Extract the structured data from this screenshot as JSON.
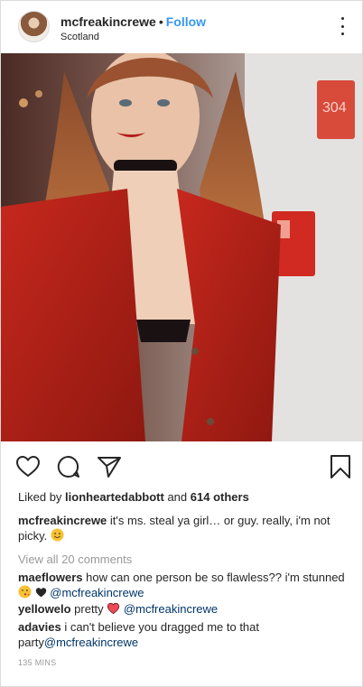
{
  "post": {
    "username": "mcfreakincrewe",
    "separator": "•",
    "follow_label": "Follow",
    "location": "Scotland"
  },
  "icons": {
    "like": "heart-outline-icon",
    "comment": "comment-bubble-icon",
    "share": "paper-plane-icon",
    "save": "bookmark-icon",
    "more": "more-options-icon"
  },
  "likes": {
    "prefix": "Liked by",
    "user": "lionheartedabbott",
    "suffix": "and",
    "others": "614 others"
  },
  "caption": {
    "user": "mcfreakincrewe",
    "text": "it's ms. steal ya girl… or guy. really, i'm not picky."
  },
  "view_all_comments": "View all 20 comments",
  "comments": [
    {
      "user": "maeflowers",
      "text": "how can one person be so flawless?? i'm stunned",
      "mention": "@mcfreakincrewe"
    },
    {
      "user": "yellowelo",
      "text": "pretty",
      "mention": "@mcfreakincrewe"
    },
    {
      "user": "adavies",
      "text": "i can't believe you dragged me to that party",
      "mention": "@mcfreakincrewe"
    }
  ],
  "timestamp": "135 MINS",
  "colors": {
    "link_blue": "#3897f0",
    "mention": "#003569",
    "muted": "#999999",
    "text": "#262626",
    "heart_red": "#ed4956"
  }
}
